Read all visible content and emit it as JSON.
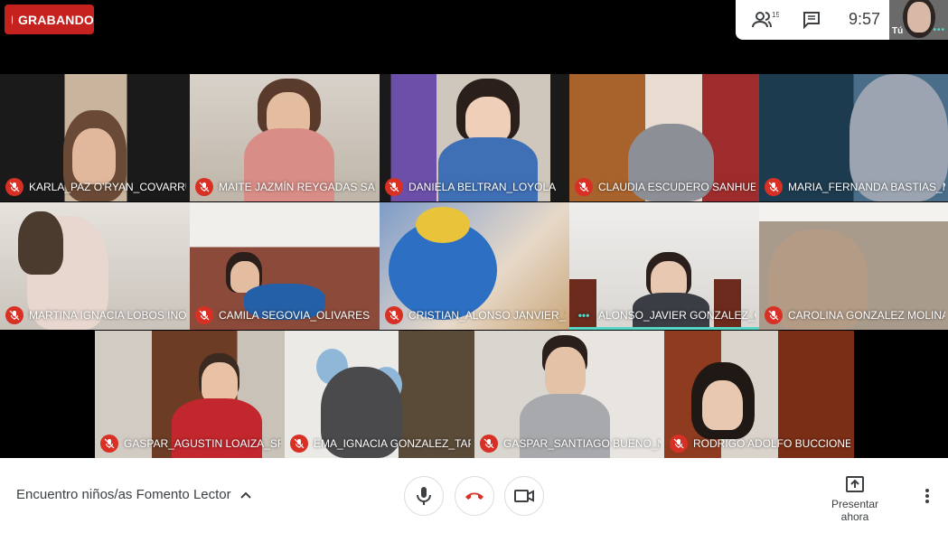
{
  "recording": {
    "label": "GRABANDO"
  },
  "topbar": {
    "participants_count": "15",
    "time": "9:57"
  },
  "self_view": {
    "label": "Tú"
  },
  "participants": [
    {
      "name": "KARLA_PAZ O'RYAN_COVARRUBIAS",
      "muted": true
    },
    {
      "name": "MAITE JAZMÍN REYGADAS SALINAS",
      "muted": true
    },
    {
      "name": "DANIELA BELTRAN_LOYOLA",
      "muted": true
    },
    {
      "name": "CLAUDIA ESCUDERO SANHUEZA",
      "muted": true
    },
    {
      "name": "MARIA_FERNANDA BASTIAS_MOR...",
      "muted": true
    },
    {
      "name": "MARTINA IGNACIA LOBOS INOSTR...",
      "muted": true
    },
    {
      "name": "CAMILA SEGOVIA_OLIVARES",
      "muted": true
    },
    {
      "name": "CRISTIAN_ALONSO JANVIER_YAÑ...",
      "muted": true
    },
    {
      "name": "ALONSO_JAVIER GONZALEZ_ORD...",
      "muted": false,
      "speaking": true
    },
    {
      "name": "CAROLINA GONZALEZ MOLINA",
      "muted": true
    },
    {
      "name": "GASPAR_AGUSTIN LOAIZA_SFEIR",
      "muted": true
    },
    {
      "name": "EMA_IGNACIA GONZALEZ_TAPIA",
      "muted": true
    },
    {
      "name": "GASPAR_SANTIAGO BUENO_MUÑOZ",
      "muted": true
    },
    {
      "name": "RODRIGO ADOLFO BUCCIONE REED",
      "muted": true
    }
  ],
  "bottom_bar": {
    "meeting_title": "Encuentro niños/as Fomento Lector",
    "present_label": "Presentar ahora"
  },
  "colors": {
    "record": "#c5221f",
    "muted": "#d93025",
    "speaking": "#56d6c4"
  }
}
